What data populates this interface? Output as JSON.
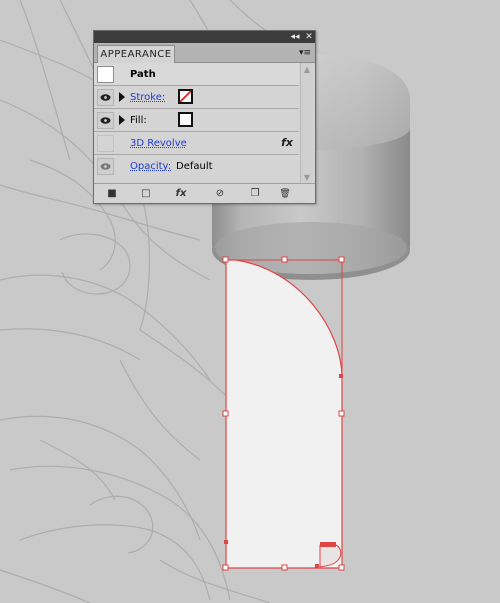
{
  "panel": {
    "title": "APPEARANCE",
    "collapse_glyph": "◂◂",
    "close_glyph": "✕",
    "menu_glyph": "▾≡",
    "rows": [
      {
        "label": "Path",
        "selected": true
      },
      {
        "label": "Stroke:",
        "swatch": "none"
      },
      {
        "label": "Fill:",
        "swatch": "white"
      },
      {
        "label": "3D Revolve",
        "fx": "fx"
      },
      {
        "label": "Opacity:",
        "value": "Default"
      }
    ],
    "scroll_up": "▲",
    "scroll_down": "▼",
    "toolbar": {
      "stroke_icon": "■",
      "fill_icon": "□",
      "fx_icon": "fx",
      "clear_icon": "⊘",
      "duplicate_icon": "❐",
      "delete_icon": "🗑"
    }
  },
  "colors": {
    "canvas": "#c9c9c9",
    "selection": "#e04545",
    "shape_fill": "#f2f1f1",
    "link": "#1d3cd4",
    "sketch_lines": "#a9a9a9"
  }
}
